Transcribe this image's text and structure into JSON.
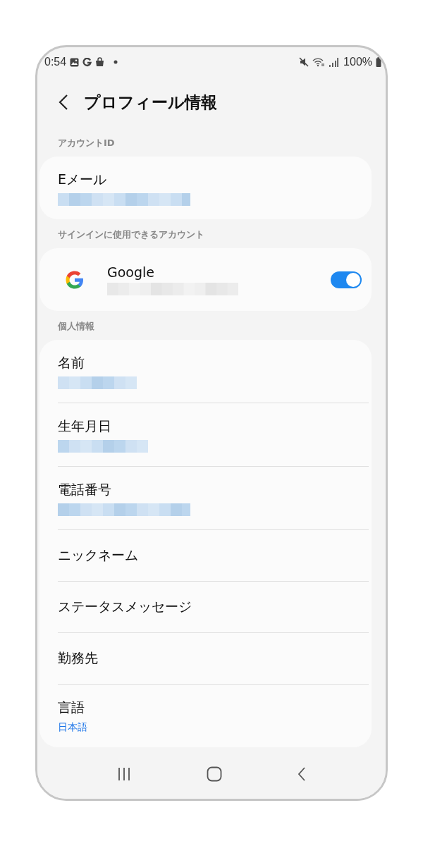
{
  "status_bar": {
    "time": "0:54",
    "battery": "100%"
  },
  "header": {
    "title": "プロフィール情報"
  },
  "sections": [
    {
      "label": "アカウントID",
      "items": [
        {
          "kind": "field",
          "label": "Eメール",
          "redacted": true
        }
      ]
    },
    {
      "label": "サインインに使用できるアカウント",
      "items": [
        {
          "kind": "account",
          "label": "Google",
          "redacted": true,
          "on": true
        }
      ]
    },
    {
      "label": "個人情報",
      "items": [
        {
          "kind": "field",
          "label": "名前",
          "redacted": true
        },
        {
          "kind": "field",
          "label": "生年月日",
          "redacted": true
        },
        {
          "kind": "field",
          "label": "電話番号",
          "redacted": true
        },
        {
          "kind": "plain",
          "label": "ニックネーム"
        },
        {
          "kind": "plain",
          "label": "ステータスメッセージ"
        },
        {
          "kind": "plain",
          "label": "勤務先"
        },
        {
          "kind": "field",
          "label": "言語",
          "value": "日本語"
        }
      ]
    }
  ]
}
